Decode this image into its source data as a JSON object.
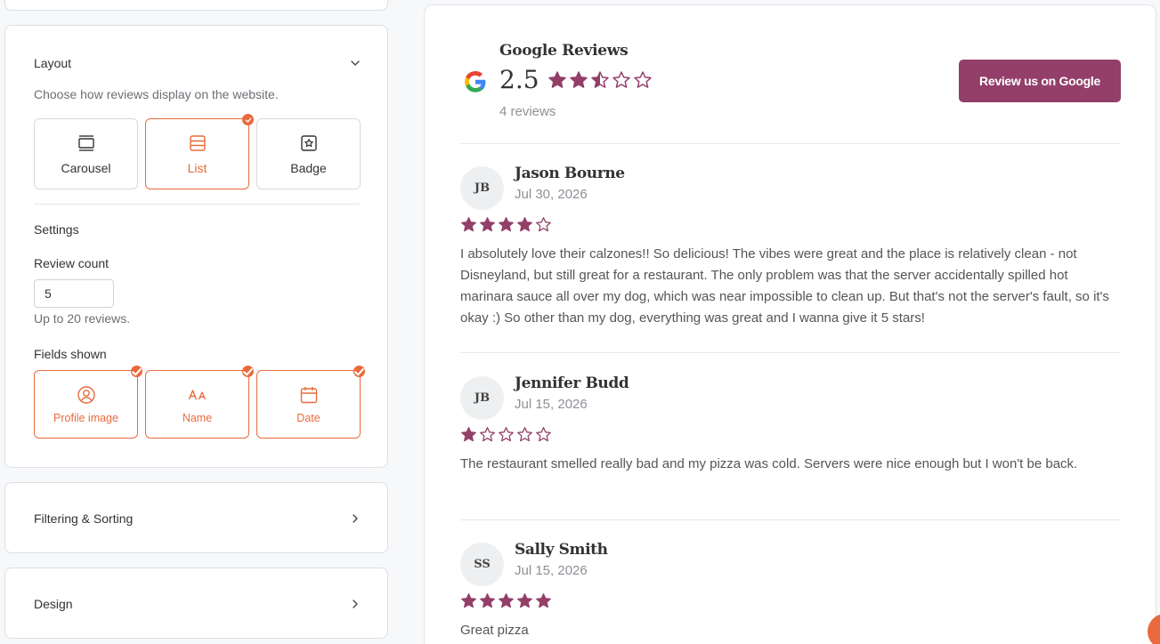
{
  "panel": {
    "layout": {
      "title": "Layout",
      "description": "Choose how reviews display on the website.",
      "options": [
        {
          "label": "Carousel",
          "selected": false
        },
        {
          "label": "List",
          "selected": true
        },
        {
          "label": "Badge",
          "selected": false
        }
      ]
    },
    "settings": {
      "title": "Settings",
      "review_count_label": "Review count",
      "review_count_value": "5",
      "review_count_hint": "Up to 20 reviews.",
      "fields_label": "Fields shown",
      "fields": [
        {
          "label": "Profile image",
          "icon": "user-circle-icon",
          "checked": true
        },
        {
          "label": "Name",
          "icon": "font-icon",
          "checked": true
        },
        {
          "label": "Date",
          "icon": "calendar-icon",
          "checked": true
        }
      ]
    },
    "filtering": {
      "title": "Filtering & Sorting"
    },
    "design": {
      "title": "Design"
    }
  },
  "widget": {
    "title": "Google Reviews",
    "rating": "2.5",
    "rating_value": 2.5,
    "review_count": "4 reviews",
    "button_label": "Review us on Google",
    "reviews": [
      {
        "initials": "JB",
        "name": "Jason Bourne",
        "date": "Jul 30, 2026",
        "stars": 4,
        "text": "I absolutely love their calzones!! So delicious! The vibes were great and the place is relatively clean - not Disneyland, but still great for a restaurant. The only problem was that the server accidentally spilled hot marinara sauce all over my dog, which was near impossible to clean up. But that's not the server's fault, so it's okay :) So other than my dog, everything was great and I wanna give it 5 stars!"
      },
      {
        "initials": "JB",
        "name": "Jennifer Budd",
        "date": "Jul 15, 2026",
        "stars": 1,
        "text": "The restaurant smelled really bad and my pizza was cold. Servers were nice enough but I won't be back."
      },
      {
        "initials": "SS",
        "name": "Sally Smith",
        "date": "Jul 15, 2026",
        "stars": 5,
        "text": "Great pizza"
      }
    ]
  },
  "colors": {
    "accent": "#e96a3c",
    "brand": "#933f69",
    "star": "#933f69"
  }
}
